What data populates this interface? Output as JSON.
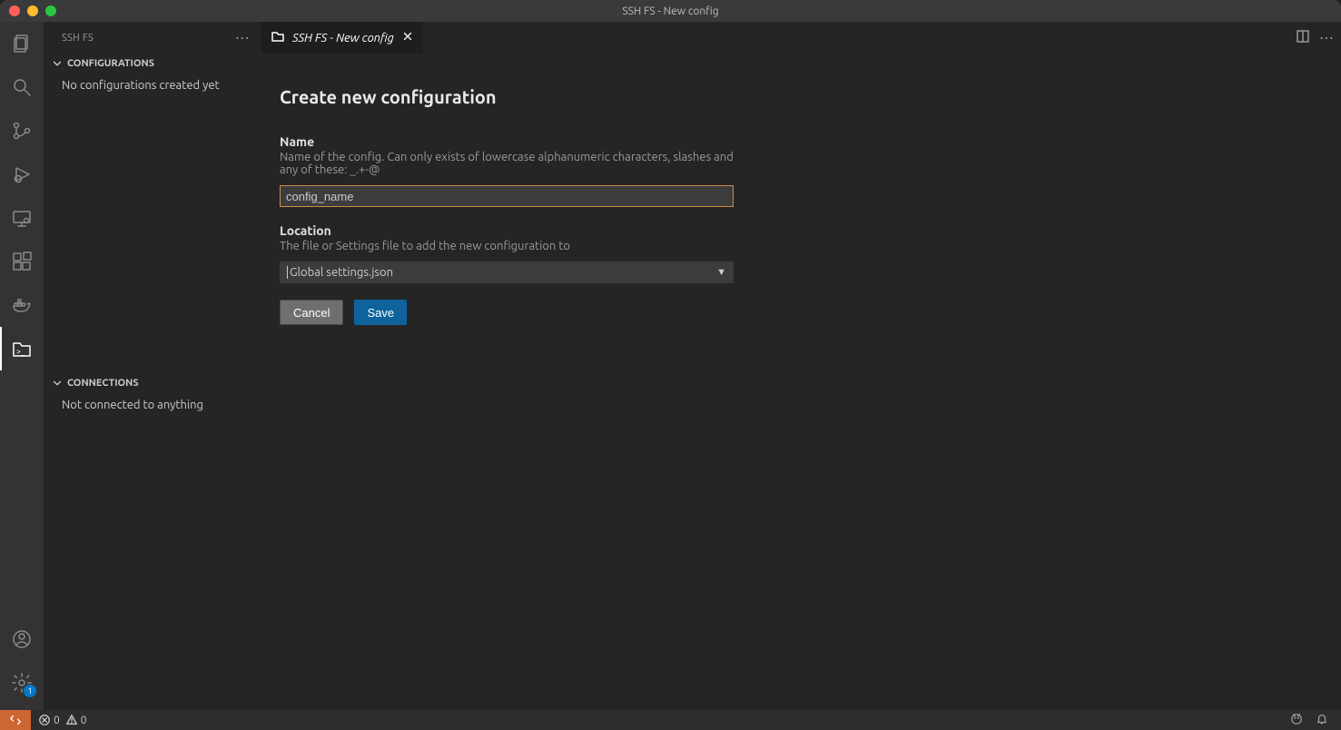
{
  "window": {
    "title": "SSH FS - New config"
  },
  "sidebar": {
    "title": "SSH FS",
    "sections": {
      "configurations": {
        "label": "CONFIGURATIONS",
        "empty": "No configurations created yet"
      },
      "connections": {
        "label": "CONNECTIONS",
        "empty": "Not connected to anything"
      }
    }
  },
  "tabs": [
    {
      "label": "SSH FS - New config"
    }
  ],
  "form": {
    "heading": "Create new configuration",
    "name": {
      "label": "Name",
      "description": "Name of the config. Can only exists of lowercase alphanumeric characters, slashes and any of these: _.+-@",
      "value": "config_name"
    },
    "location": {
      "label": "Location",
      "description": "The file or Settings file to add the new configuration to",
      "selected": "Global settings.json"
    },
    "buttons": {
      "cancel": "Cancel",
      "save": "Save"
    }
  },
  "status": {
    "errors": "0",
    "warnings": "0"
  },
  "activity": {
    "settings_badge": "1"
  }
}
